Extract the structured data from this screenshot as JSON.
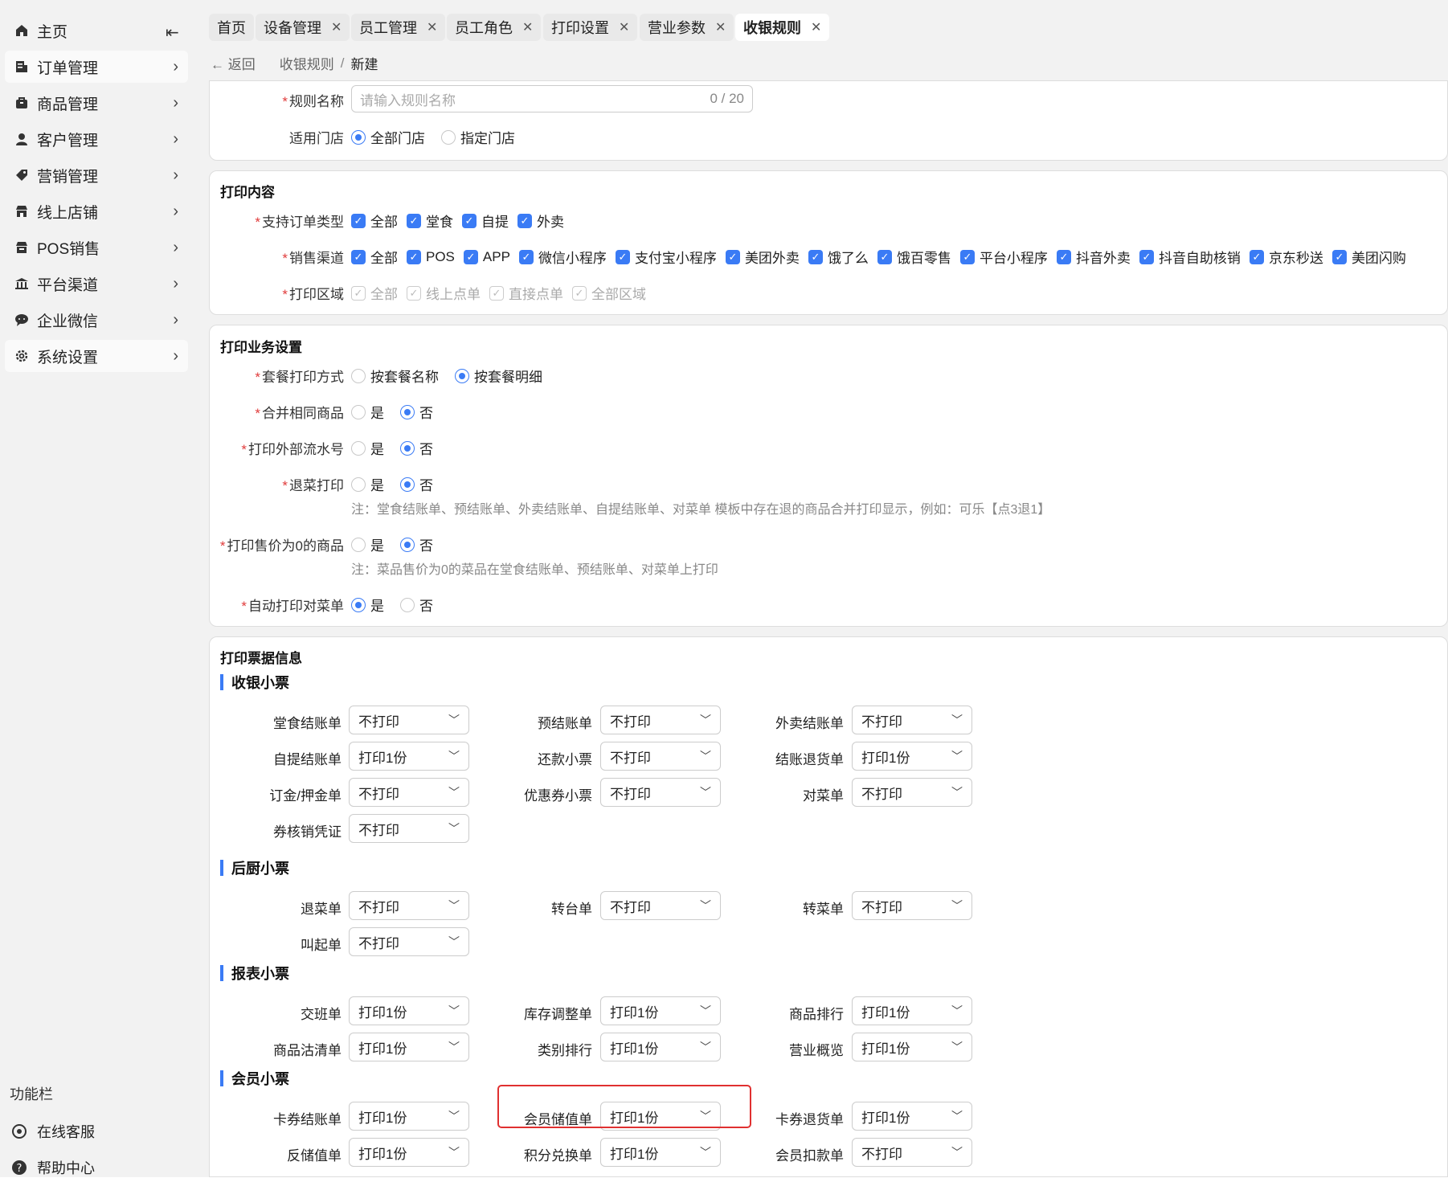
{
  "sidebar": {
    "items": [
      {
        "label": "主页",
        "icon": "home-icon"
      },
      {
        "label": "订单管理",
        "icon": "order-icon"
      },
      {
        "label": "商品管理",
        "icon": "product-icon"
      },
      {
        "label": "客户管理",
        "icon": "customer-icon"
      },
      {
        "label": "营销管理",
        "icon": "tag-icon"
      },
      {
        "label": "线上店铺",
        "icon": "store-icon"
      },
      {
        "label": "POS销售",
        "icon": "pos-icon"
      },
      {
        "label": "平台渠道",
        "icon": "bank-icon"
      },
      {
        "label": "企业微信",
        "icon": "chat-icon"
      },
      {
        "label": "系统设置",
        "icon": "gear-icon"
      }
    ],
    "func_title": "功能栏",
    "func_items": [
      {
        "label": "在线客服",
        "icon": "service-icon"
      },
      {
        "label": "帮助中心",
        "icon": "help-icon"
      }
    ]
  },
  "tabs": [
    "首页",
    "设备管理",
    "员工管理",
    "员工角色",
    "打印设置",
    "营业参数",
    "收银规则"
  ],
  "breadcrumb": {
    "back": "返回",
    "parent": "收银规则",
    "sep": "/",
    "current": "新建"
  },
  "basic": {
    "name_label": "规则名称",
    "name_placeholder": "请输入规则名称",
    "name_count": "0 / 20",
    "store_label": "适用门店",
    "store_opts": [
      "全部门店",
      "指定门店"
    ]
  },
  "print_content": {
    "title": "打印内容",
    "order_type_label": "支持订单类型",
    "order_types": [
      "全部",
      "堂食",
      "自提",
      "外卖"
    ],
    "channel_label": "销售渠道",
    "channels": [
      "全部",
      "POS",
      "APP",
      "微信小程序",
      "支付宝小程序",
      "美团外卖",
      "饿了么",
      "饿百零售",
      "平台小程序",
      "抖音外卖",
      "抖音自助核销",
      "京东秒送",
      "美团闪购"
    ],
    "area_label": "打印区域",
    "areas": [
      "全部",
      "线上点单",
      "直接点单",
      "全部区域"
    ]
  },
  "business": {
    "title": "打印业务设置",
    "set_label": "套餐打印方式",
    "set_opts": [
      "按套餐名称",
      "按套餐明细"
    ],
    "merge_label": "合并相同商品",
    "ext_label": "打印外部流水号",
    "refund_label": "退菜打印",
    "refund_note": "注：堂食结账单、预结账单、外卖结账单、自提结账单、对菜单 模板中存在退的商品合并打印显示，例如：可乐【点3退1】",
    "zero_label": "打印售价为0的商品",
    "zero_note": "注：菜品售价为0的菜品在堂食结账单、预结账单、对菜单上打印",
    "auto_label": "自动打印对菜单",
    "yes": "是",
    "no": "否"
  },
  "tickets": {
    "title": "打印票据信息",
    "groups": [
      {
        "name": "收银小票",
        "items": [
          {
            "label": "堂食结账单",
            "value": "不打印"
          },
          {
            "label": "预结账单",
            "value": "不打印"
          },
          {
            "label": "外卖结账单",
            "value": "不打印"
          },
          {
            "label": "自提结账单",
            "value": "打印1份"
          },
          {
            "label": "还款小票",
            "value": "不打印"
          },
          {
            "label": "结账退货单",
            "value": "打印1份"
          },
          {
            "label": "订金/押金单",
            "value": "不打印"
          },
          {
            "label": "优惠券小票",
            "value": "不打印"
          },
          {
            "label": "对菜单",
            "value": "不打印"
          },
          {
            "label": "券核销凭证",
            "value": "不打印"
          }
        ]
      },
      {
        "name": "后厨小票",
        "items": [
          {
            "label": "退菜单",
            "value": "不打印"
          },
          {
            "label": "转台单",
            "value": "不打印"
          },
          {
            "label": "转菜单",
            "value": "不打印"
          },
          {
            "label": "叫起单",
            "value": "不打印"
          }
        ]
      },
      {
        "name": "报表小票",
        "items": [
          {
            "label": "交班单",
            "value": "打印1份"
          },
          {
            "label": "库存调整单",
            "value": "打印1份"
          },
          {
            "label": "商品排行",
            "value": "打印1份"
          },
          {
            "label": "商品沽清单",
            "value": "打印1份"
          },
          {
            "label": "类别排行",
            "value": "打印1份"
          },
          {
            "label": "营业概览",
            "value": "打印1份"
          }
        ]
      },
      {
        "name": "会员小票",
        "items": [
          {
            "label": "卡券结账单",
            "value": "打印1份"
          },
          {
            "label": "会员储值单",
            "value": "打印1份"
          },
          {
            "label": "卡券退货单",
            "value": "打印1份"
          },
          {
            "label": "反储值单",
            "value": "打印1份"
          },
          {
            "label": "积分兑换单",
            "value": "打印1份"
          },
          {
            "label": "会员扣款单",
            "value": "不打印"
          }
        ]
      }
    ]
  },
  "colors": {
    "accent": "#3a7bf5",
    "required": "#e03b3b",
    "highlight": "#e03030"
  }
}
